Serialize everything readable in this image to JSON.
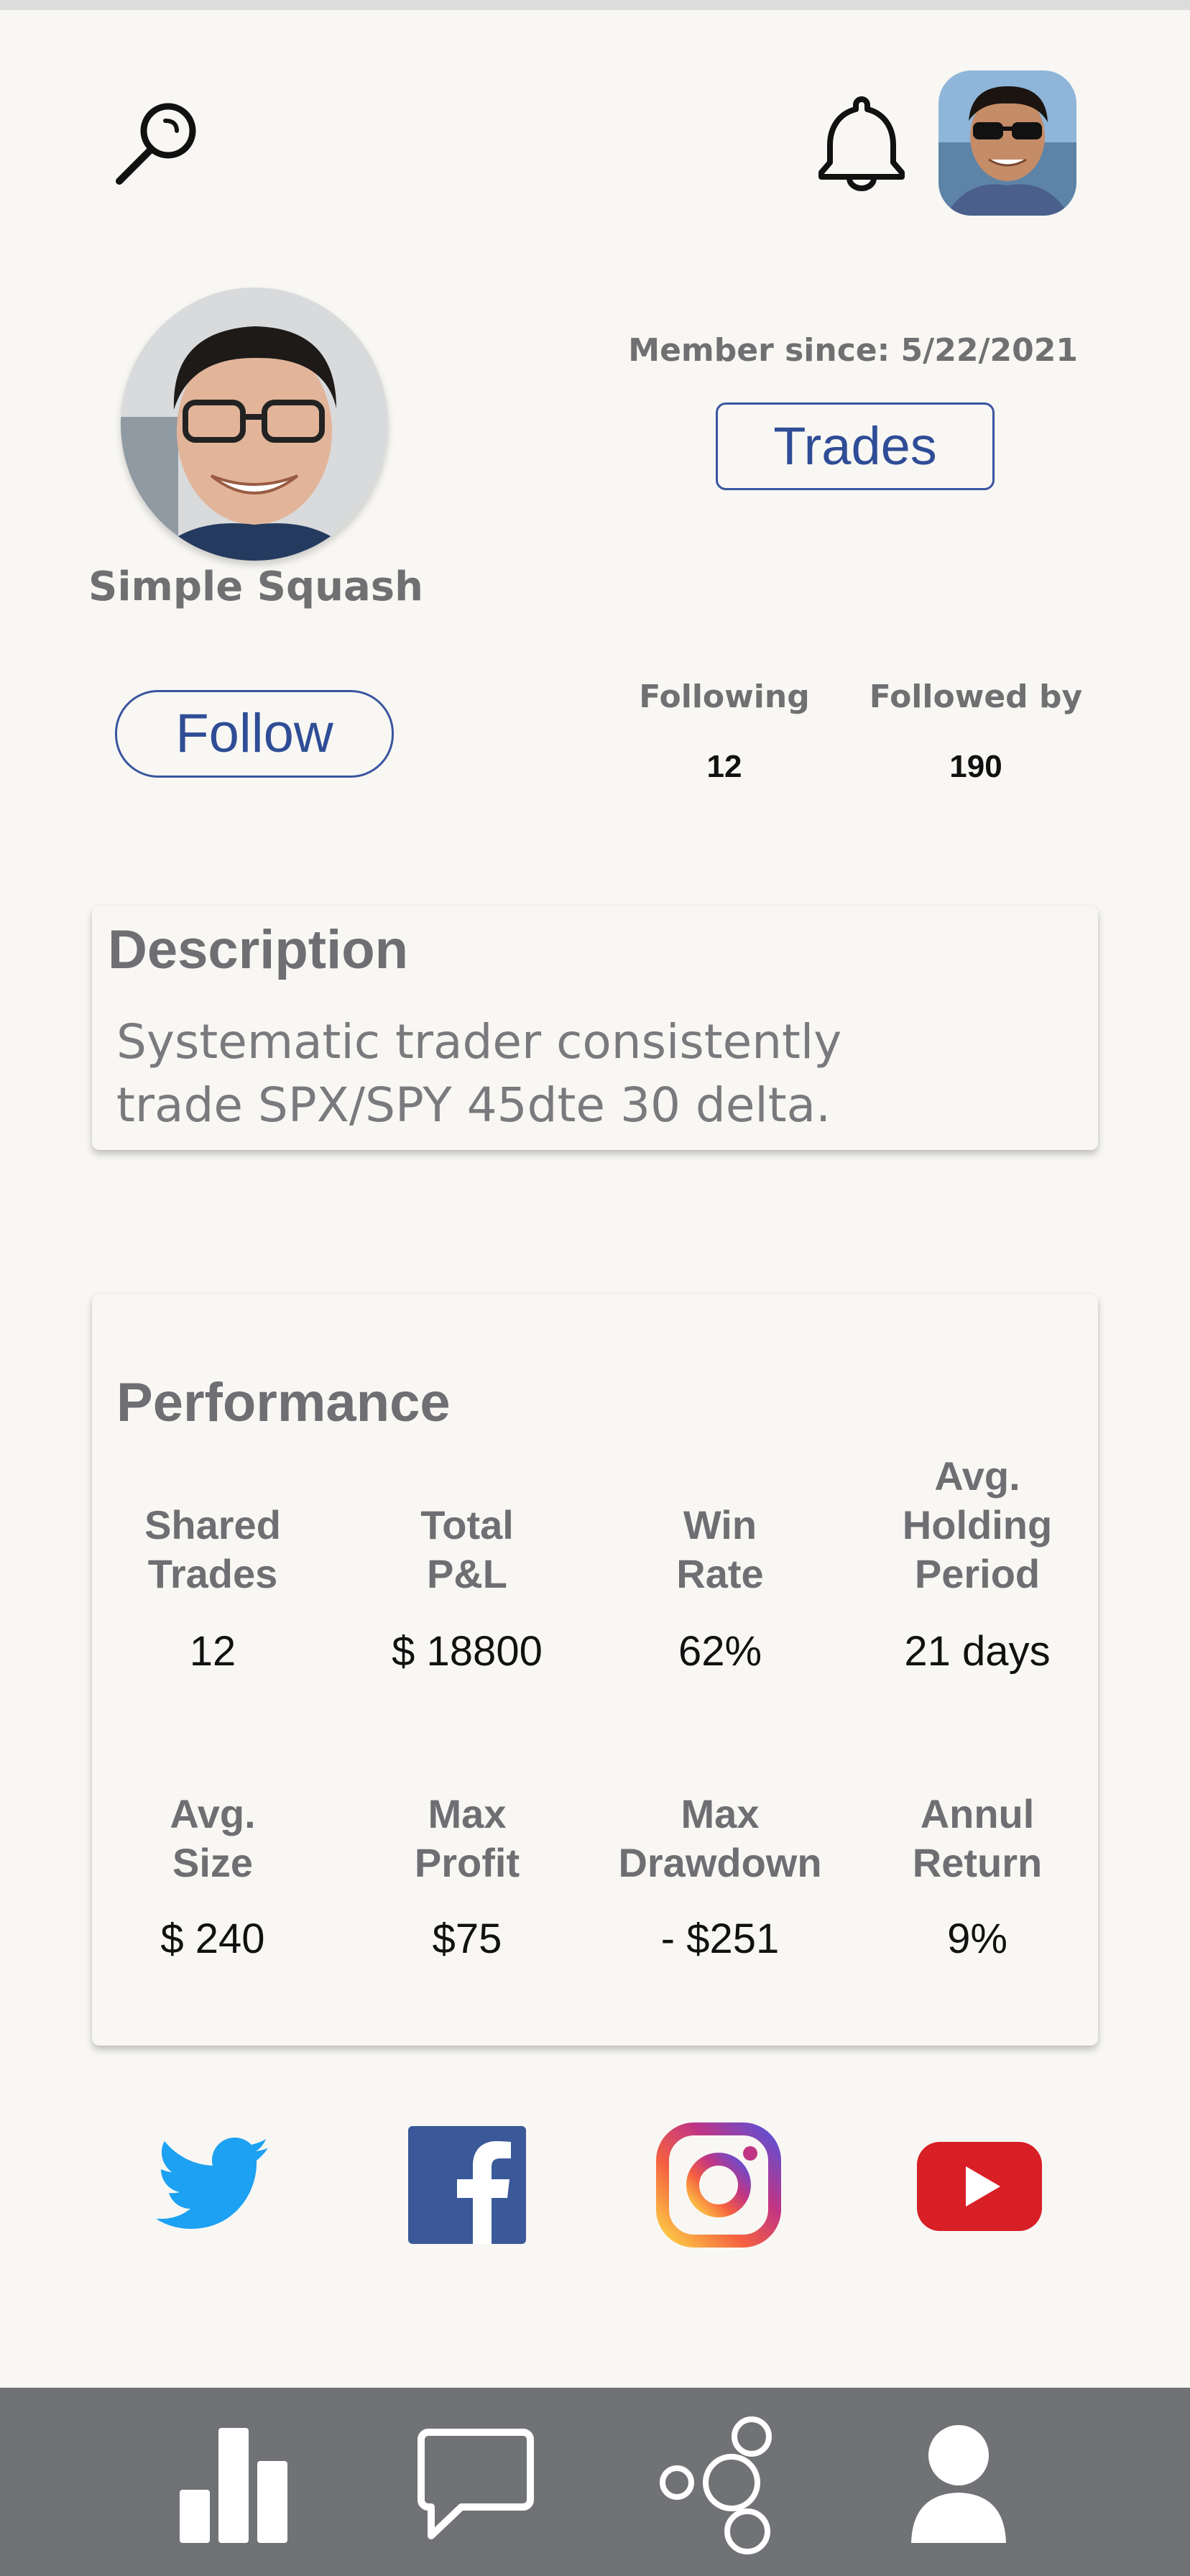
{
  "header": {
    "search_icon": "search-icon",
    "bell_icon": "bell-icon",
    "avatar_icon": "user-avatar"
  },
  "profile": {
    "name": "Simple Squash",
    "member_since": "Member since: 5/22/2021",
    "trades_label": "Trades",
    "follow_label": "Follow",
    "following_label": "Following",
    "following_count": "12",
    "followed_by_label": "Followed by",
    "followed_by_count": "190"
  },
  "description": {
    "title": "Description",
    "line1": "Systematic trader consistently",
    "line2": "trade SPX/SPY 45dte 30 delta."
  },
  "performance": {
    "title": "Performance",
    "row1": [
      {
        "label_lines": [
          "Shared",
          "Trades"
        ],
        "value": "12"
      },
      {
        "label_lines": [
          "Total",
          "P&L"
        ],
        "value": "$ 18800"
      },
      {
        "label_lines": [
          "Win",
          "Rate"
        ],
        "value": "62%"
      },
      {
        "label_lines": [
          "Avg.",
          "Holding",
          "Period"
        ],
        "value": "21 days"
      }
    ],
    "row2": [
      {
        "label_lines": [
          "Avg.",
          "Size"
        ],
        "value": "$ 240"
      },
      {
        "label_lines": [
          "Max",
          "Profit"
        ],
        "value": "$75"
      },
      {
        "label_lines": [
          "Max",
          "Drawdown"
        ],
        "value": "- $251"
      },
      {
        "label_lines": [
          "Annul",
          "Return"
        ],
        "value": "9%"
      }
    ]
  },
  "social": {
    "twitter": "twitter-icon",
    "facebook": "facebook-icon",
    "instagram": "instagram-icon",
    "youtube": "youtube-icon",
    "colors": {
      "twitter": "#1da1f2",
      "facebook": "#3b5998",
      "youtube": "#d81f26"
    }
  },
  "nav": {
    "items": [
      "chart-icon",
      "chat-icon",
      "network-icon",
      "profile-icon"
    ],
    "background": "#717275"
  }
}
